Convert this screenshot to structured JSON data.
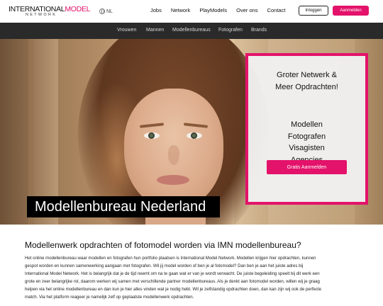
{
  "header": {
    "logo": {
      "part1": "INTERNATIONAL",
      "part2": "MODEL",
      "sub": "NETWORK"
    },
    "language": {
      "icon": "globe-icon",
      "label": "NL"
    },
    "nav": [
      "Jobs",
      "Network",
      "PlayModels",
      "Over ons",
      "Contact"
    ],
    "login_label": "Inloggen",
    "register_label": "Aanmelden"
  },
  "subnav": [
    "Vrouwen",
    "Mannen",
    "Modellenbureaus",
    "Fotografen",
    "Brands"
  ],
  "hero": {
    "title": "Modellenbureau Nederland",
    "panel": {
      "headline": [
        "Groter Netwerk &",
        "Meer Opdrachten!"
      ],
      "items": [
        "Modellen",
        "Fotografen",
        "Visagisten",
        "Agencies"
      ],
      "cta_label": "Gratis Aanmelden"
    }
  },
  "content": {
    "title": "Modellenwerk opdrachten of fotomodel worden via IMN modellenbureau?",
    "lines": [
      "Het online modellenbureau waar modellen en fotografen hun portfolio plaatsen is International Model Network. Modellen krijgen hier opdrachten, kunnen",
      "gespot worden en kunnen samenwerking aangaan met fotografen. Wil jij model worden of ben je al fotomodel? Dan ben je aan het juiste adres bij",
      "International Model Network. Het is belangrijk dat je de tijd neemt om na te gaan wat er van je wordt verwacht. De juiste begeleiding speelt bij dit werk een",
      "grote en zeer belangrijke rol, daarom werken wij samen met verschillende partner modellenbureaus. Als je denkt aan fotomodel worden, willen wij je graag",
      "helpen via het online modellenbureau en dan kun je hier alles vinden wat je nodig hebt. Wil je zelfstandig opdrachten doen, dan kan zijn wij ook de perfecte",
      "match. Via het platform reageer je namelijk zelf op geplaatste modellenwerk opdrachten."
    ]
  },
  "colors": {
    "accent": "#e3126a",
    "subnav_bg": "#2a2a2a"
  }
}
